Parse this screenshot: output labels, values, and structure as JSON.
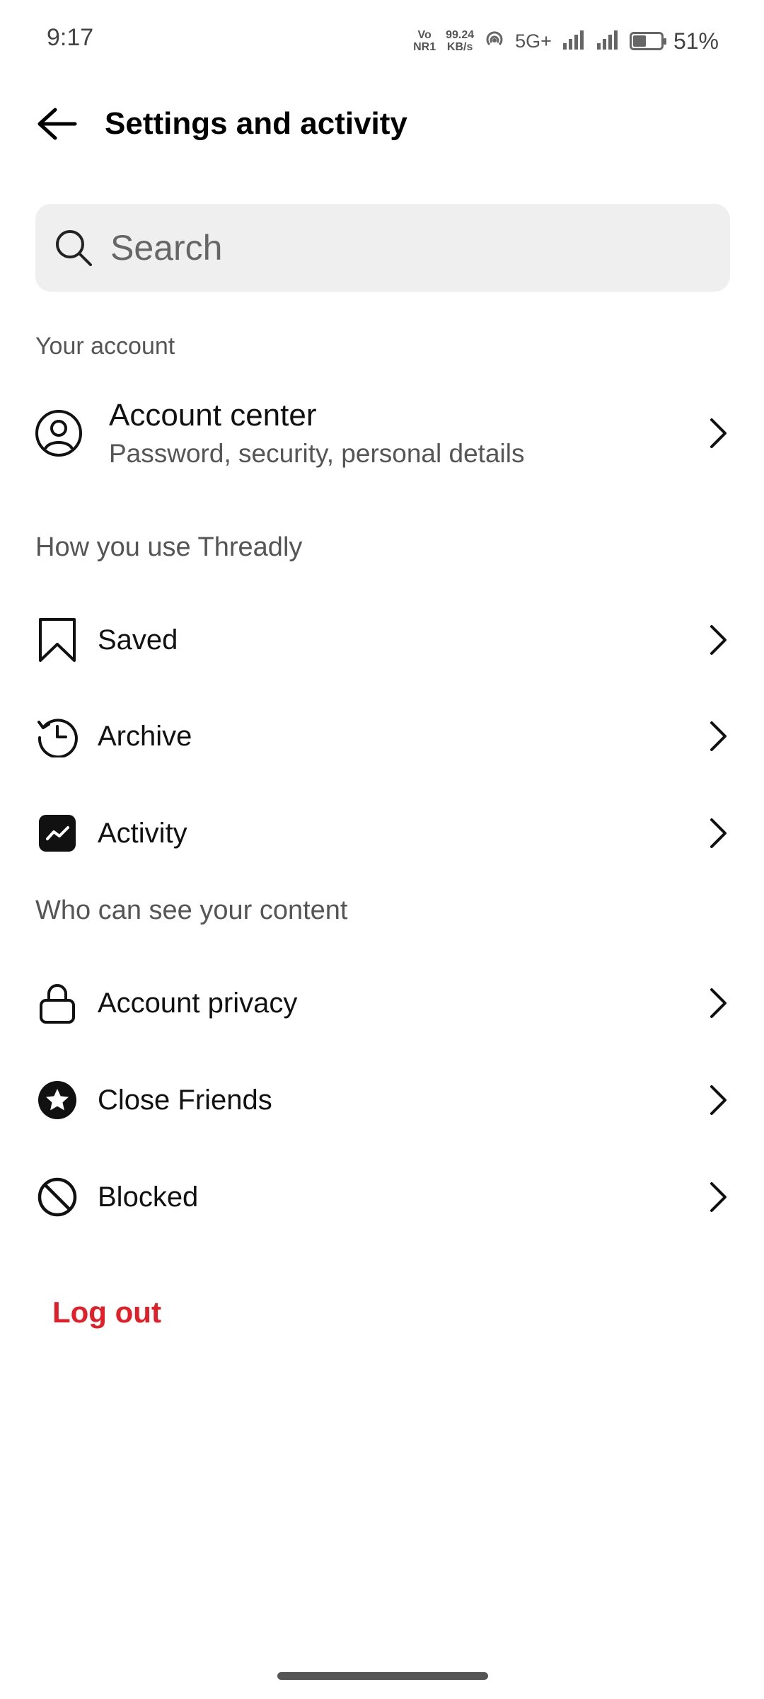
{
  "status": {
    "time": "9:17",
    "volte": "Vo",
    "volte2": "NR1",
    "speed_value": "99.24",
    "speed_unit": "KB/s",
    "network": "5G+",
    "battery_level": 0.51,
    "battery_text": "51%"
  },
  "header": {
    "title": "Settings and activity"
  },
  "search": {
    "placeholder": "Search"
  },
  "sections": {
    "your_account": "Your account",
    "how_you_use": "How you use Threadly",
    "who_can_see": "Who can see your content"
  },
  "account_center": {
    "title": "Account center",
    "subtitle": "Password, security, personal details"
  },
  "items": {
    "saved": "Saved",
    "archive": "Archive",
    "activity": "Activity",
    "account_privacy": "Account privacy",
    "close_friends": "Close Friends",
    "blocked": "Blocked"
  },
  "logout": {
    "label": "Log out",
    "color": "#e41e26"
  }
}
